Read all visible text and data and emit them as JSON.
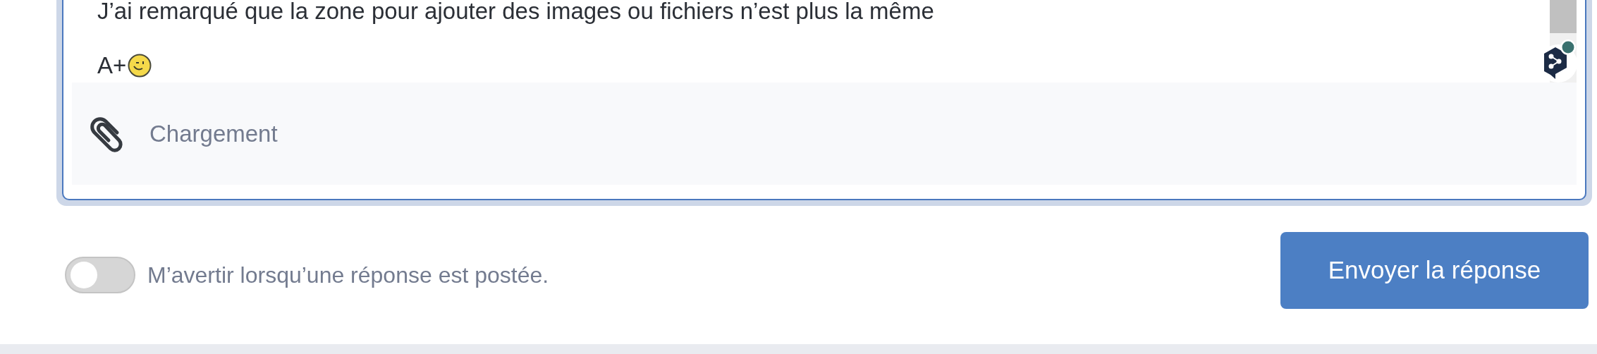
{
  "message": {
    "lines": [
      "J’ai remarqué que la zone pour ajouter des images ou fichiers n’est plus la même",
      "A+"
    ]
  },
  "attachment": {
    "label": "Chargement"
  },
  "notify_toggle": {
    "on": false,
    "label": "M’avertir lorsqu’une réponse est postée."
  },
  "submit_button": {
    "label": "Envoyer la réponse"
  }
}
